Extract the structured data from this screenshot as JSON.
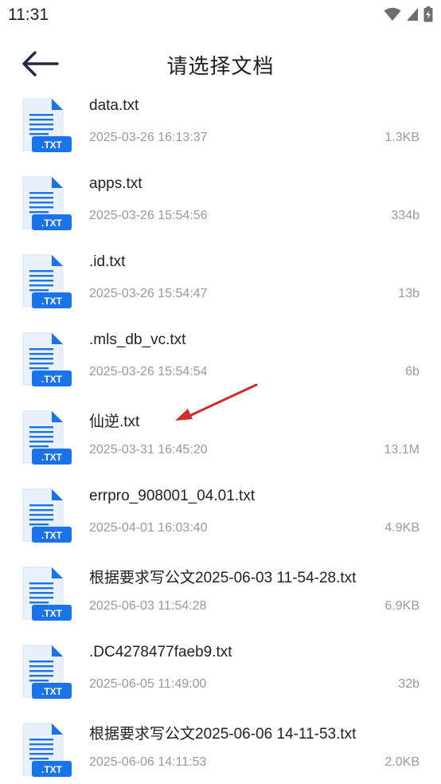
{
  "status_bar": {
    "time": "11:31"
  },
  "header": {
    "title": "请选择文档"
  },
  "file_badge": ".TXT",
  "files": [
    {
      "name": "data.txt",
      "date": "2025-03-26 16:13:37",
      "size": "1.3KB"
    },
    {
      "name": "apps.txt",
      "date": "2025-03-26 15:54:56",
      "size": "334b"
    },
    {
      "name": ".id.txt",
      "date": "2025-03-26 15:54:47",
      "size": "13b"
    },
    {
      "name": ".mls_db_vc.txt",
      "date": "2025-03-26 15:54:54",
      "size": "6b"
    },
    {
      "name": "仙逆.txt",
      "date": "2025-03-31 16:45:20",
      "size": "13.1M"
    },
    {
      "name": "errpro_908001_04.01.txt",
      "date": "2025-04-01 16:03:40",
      "size": "4.9KB"
    },
    {
      "name": "根据要求写公文2025-06-03 11-54-28.txt",
      "date": "2025-06-03 11:54:28",
      "size": "6.9KB"
    },
    {
      "name": ".DC4278477faeb9.txt",
      "date": "2025-06-05 11:49:00",
      "size": "32b"
    },
    {
      "name": "根据要求写公文2025-06-06 14-11-53.txt",
      "date": "2025-06-06 14:11:53",
      "size": "2.0KB"
    }
  ],
  "colors": {
    "accent": "#1a73e8",
    "annotation_arrow": "#d42a2a"
  }
}
